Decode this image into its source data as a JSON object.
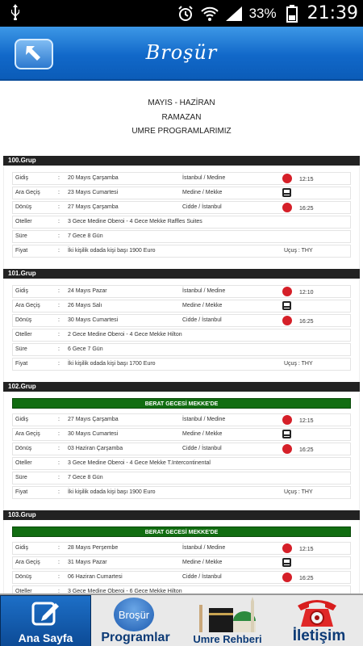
{
  "status_bar": {
    "battery_percent": "33%",
    "time": "21:39",
    "icons": [
      "usb-icon",
      "alarm-icon",
      "wifi-icon",
      "signal-icon",
      "battery-icon"
    ]
  },
  "header": {
    "title": "Broşür",
    "back_icon": "back-arrow-icon"
  },
  "intro": {
    "line1": "MAYIS - HAZİRAN",
    "line2": "RAMAZAN",
    "line3": "UMRE PROGRAMLARIMIZ"
  },
  "labels": {
    "departure": "Gidiş",
    "transit": "Ara Geçiş",
    "return": "Dönüş",
    "hotels": "Oteller",
    "duration": "Süre",
    "price": "Fiyat",
    "colon": ":"
  },
  "groups": [
    {
      "title": "100.Grup",
      "banner": "",
      "departure": {
        "date": "20 Mayıs Çarşamba",
        "route": "İstanbul / Medine",
        "time": "12:15"
      },
      "transit": {
        "date": "23 Mayıs Cumartesi",
        "route": "Medine / Mekke"
      },
      "return": {
        "date": "27 Mayıs Çarşamba",
        "route": "Cidde / İstanbul",
        "time": "16:25"
      },
      "hotels": "3 Gece Medine Oberoi - 4 Gece Mekke Raffles Suites",
      "duration": "7 Gece 8 Gün",
      "price": "İki kişilik odada kişi başı 1900 Euro",
      "flight": "Uçuş : THY"
    },
    {
      "title": "101.Grup",
      "banner": "",
      "departure": {
        "date": "24 Mayıs Pazar",
        "route": "İstanbul / Medine",
        "time": "12:10"
      },
      "transit": {
        "date": "26 Mayıs Salı",
        "route": "Medine / Mekke"
      },
      "return": {
        "date": "30 Mayıs Cumartesi",
        "route": "Cidde / İstanbul",
        "time": "16:25"
      },
      "hotels": "2 Gece Medine Oberoi - 4 Gece Mekke Hilton",
      "duration": "6 Gece 7 Gün",
      "price": "İki kişilik odada kişi başı 1700 Euro",
      "flight": "Uçuş : THY"
    },
    {
      "title": "102.Grup",
      "banner": "BERAT GECESİ MEKKE'DE",
      "departure": {
        "date": "27 Mayıs Çarşamba",
        "route": "İstanbul / Medine",
        "time": "12:15"
      },
      "transit": {
        "date": "30 Mayıs Cumartesi",
        "route": "Medine / Mekke"
      },
      "return": {
        "date": "03 Haziran Çarşamba",
        "route": "Cidde / İstanbul",
        "time": "16:25"
      },
      "hotels": "3 Gece Medine Oberoi - 4 Gece Mekke T.Intercontinental",
      "duration": "7 Gece 8 Gün",
      "price": "İki kişilik odada kişi başı 1900 Euro",
      "flight": "Uçuş : THY"
    },
    {
      "title": "103.Grup",
      "banner": "BERAT GECESİ MEKKE'DE",
      "departure": {
        "date": "28 Mayıs Perşembe",
        "route": "İstanbul / Medine",
        "time": "12:15"
      },
      "transit": {
        "date": "31 Mayıs Pazar",
        "route": "Medine / Mekke"
      },
      "return": {
        "date": "06 Haziran Cumartesi",
        "route": "Cidde / İstanbul",
        "time": "16:25"
      },
      "hotels": "3 Gece Medine Oberoi - 6 Gece Mekke Hilton",
      "duration": "",
      "price": "",
      "flight": ""
    }
  ],
  "bottom_nav": {
    "home": "Ana Sayfa",
    "brochure_badge": "Broşür",
    "programs": "Programlar",
    "umre": "Umre Rehberi",
    "contact": "İletişim"
  }
}
